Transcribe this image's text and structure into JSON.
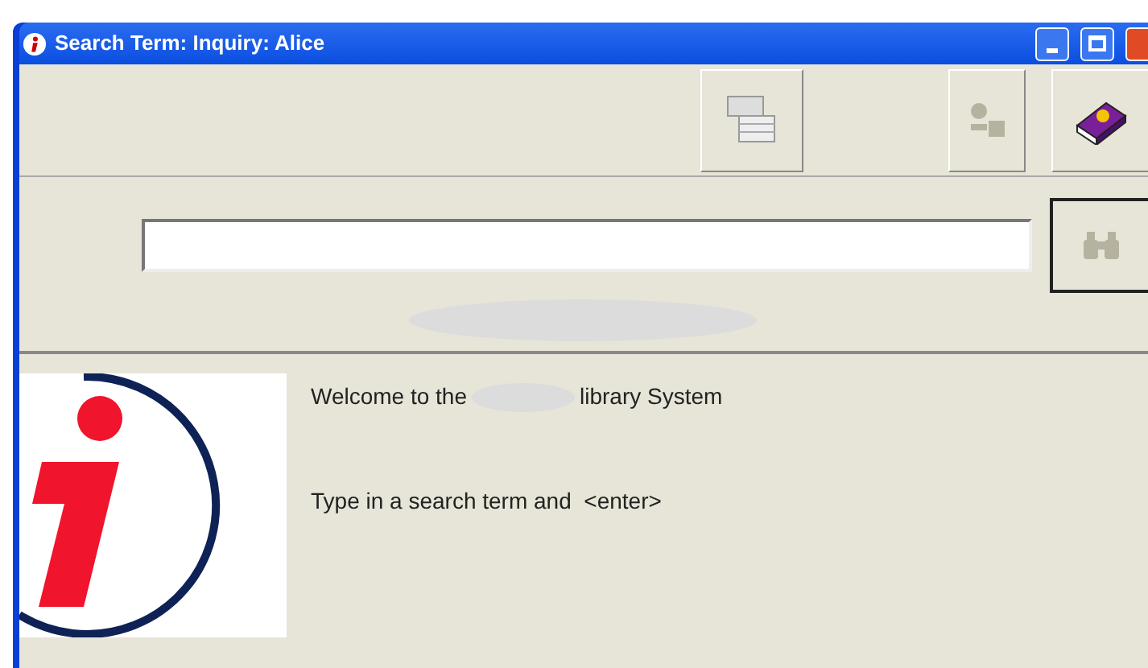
{
  "window": {
    "title": "Search Term: Inquiry: Alice"
  },
  "welcome": {
    "before": "Welcome to the",
    "after": "library System"
  },
  "instruction": "Type in a search term and  <enter>"
}
